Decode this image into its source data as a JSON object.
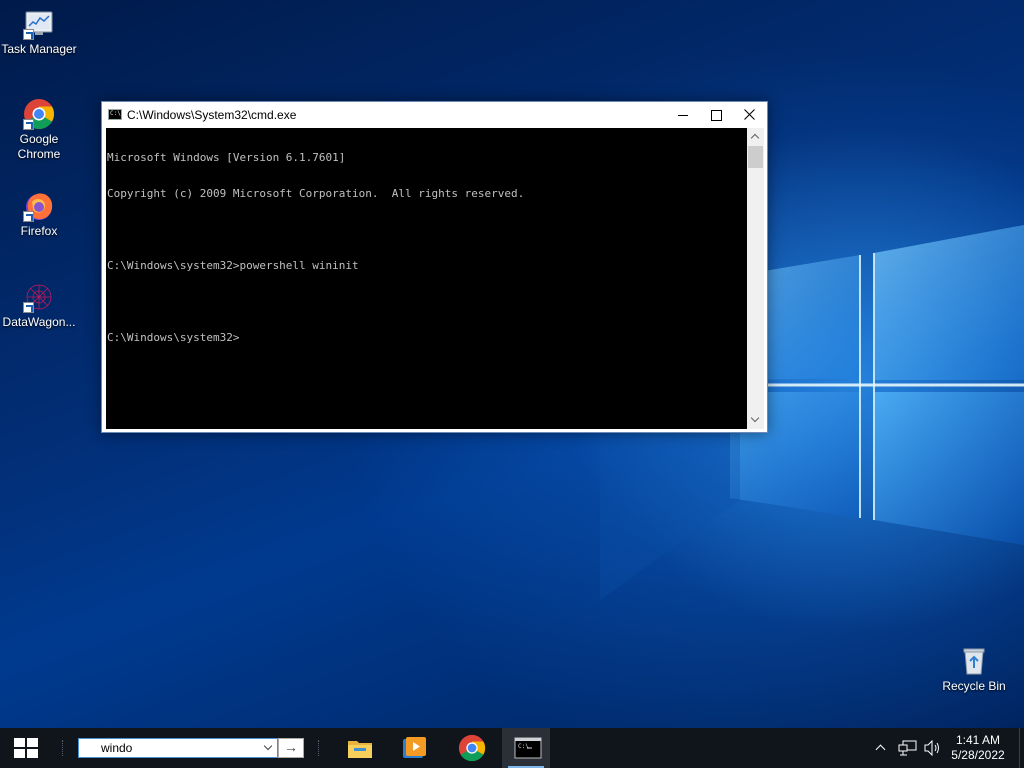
{
  "desktop_icons": [
    {
      "label": "Task Manager",
      "icon": "task-manager-icon"
    },
    {
      "label": "Google Chrome",
      "icon": "chrome-icon"
    },
    {
      "label": "Firefox",
      "icon": "firefox-icon"
    },
    {
      "label": "DataWagon...",
      "icon": "datawagon-icon"
    },
    {
      "label": "Recycle Bin",
      "icon": "recycle-bin-icon"
    }
  ],
  "cmd_window": {
    "title": "C:\\Windows\\System32\\cmd.exe",
    "console_lines": [
      "Microsoft Windows [Version 6.1.7601]",
      "Copyright (c) 2009 Microsoft Corporation.  All rights reserved.",
      "",
      "C:\\Windows\\system32>powershell wininit",
      "",
      "C:\\Windows\\system32>"
    ]
  },
  "taskbar": {
    "search": {
      "value": "windo"
    },
    "pinned_apps": [
      "file-explorer-icon",
      "media-player-icon",
      "chrome-icon",
      "cmd-icon"
    ],
    "clock": {
      "time": "1:41 AM",
      "date": "5/28/2022"
    }
  },
  "colors": {
    "taskbar": "#10151c",
    "console_bg": "#000000",
    "console_text": "#c0c0c0",
    "accent": "#7fb6ec"
  }
}
